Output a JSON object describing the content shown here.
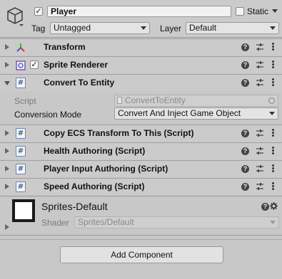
{
  "header": {
    "active": true,
    "name": "Player",
    "static_label": "Static",
    "static_checked": false,
    "tag_label": "Tag",
    "tag_value": "Untagged",
    "layer_label": "Layer",
    "layer_value": "Default"
  },
  "components": {
    "transform": {
      "title": "Transform",
      "icon": "transform-axes-icon"
    },
    "sprite_renderer": {
      "title": "Sprite Renderer",
      "icon": "sprite-renderer-icon",
      "enabled": true
    },
    "convert_to_entity": {
      "title": "Convert To Entity",
      "icon": "script-icon",
      "script_label": "Script",
      "script_value": "ConvertToEntity",
      "mode_label": "Conversion Mode",
      "mode_value": "Convert And Inject Game Object"
    },
    "copy_ecs": {
      "title": "Copy ECS Transform To This (Script)"
    },
    "health": {
      "title": "Health Authoring (Script)"
    },
    "player_input": {
      "title": "Player Input Authoring (Script)"
    },
    "speed": {
      "title": "Speed Authoring (Script)"
    }
  },
  "material": {
    "name": "Sprites-Default",
    "shader_label": "Shader",
    "shader_value": "Sprites/Default"
  },
  "add_component_label": "Add Component",
  "colors": {
    "background": "#c8c8c8",
    "script_icon": "#3d5f98",
    "transform_x": "#d9362c",
    "transform_y": "#4cae39",
    "transform_z": "#3a63c8"
  }
}
